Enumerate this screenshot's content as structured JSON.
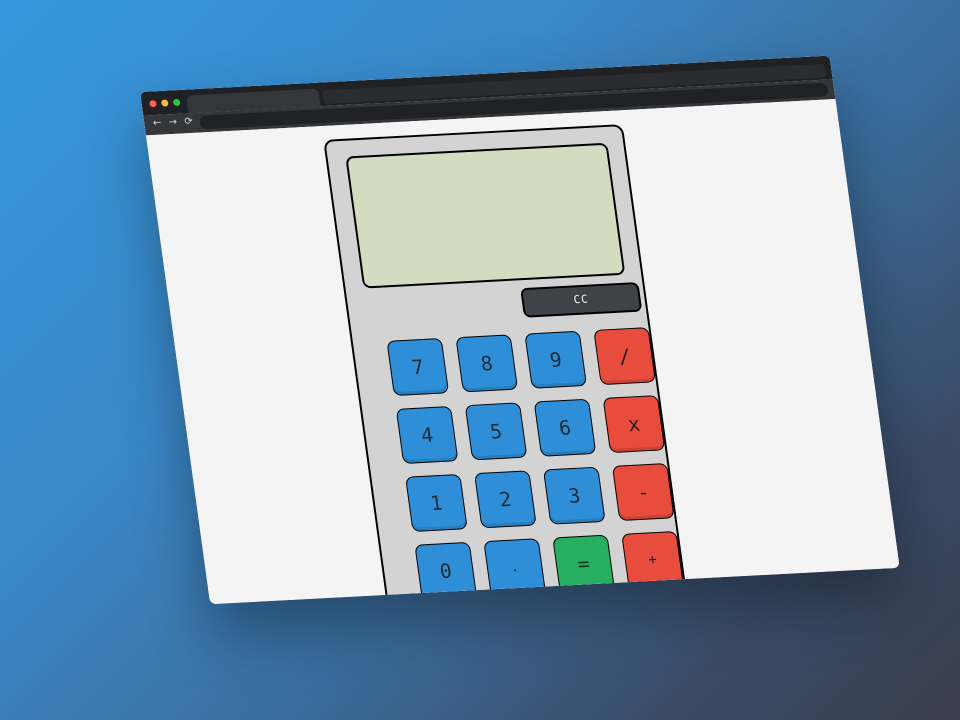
{
  "colors": {
    "background_start": "#3497dd",
    "background_end": "#3a3f4d",
    "browser_chrome": "#202124",
    "page_background": "#f4f4f4",
    "calculator_body": "#d3d3d3",
    "display": "#d1dcc0",
    "number_key": "#2e8fd8",
    "operator_key": "#e74c3c",
    "equals_key": "#27ae60",
    "clear_key": "#3d4348"
  },
  "browser": {
    "nav_icons": {
      "back": "←",
      "forward": "→",
      "reload": "⟳"
    }
  },
  "calculator": {
    "display_value": "",
    "clear_label": "CC",
    "keys": [
      {
        "label": "7",
        "type": "num"
      },
      {
        "label": "8",
        "type": "num"
      },
      {
        "label": "9",
        "type": "num"
      },
      {
        "label": "/",
        "type": "op"
      },
      {
        "label": "4",
        "type": "num"
      },
      {
        "label": "5",
        "type": "num"
      },
      {
        "label": "6",
        "type": "num"
      },
      {
        "label": "x",
        "type": "op"
      },
      {
        "label": "1",
        "type": "num"
      },
      {
        "label": "2",
        "type": "num"
      },
      {
        "label": "3",
        "type": "num"
      },
      {
        "label": "-",
        "type": "op"
      },
      {
        "label": "0",
        "type": "num"
      },
      {
        "label": ".",
        "type": "num"
      },
      {
        "label": "=",
        "type": "eq"
      },
      {
        "label": "+",
        "type": "op"
      }
    ]
  }
}
